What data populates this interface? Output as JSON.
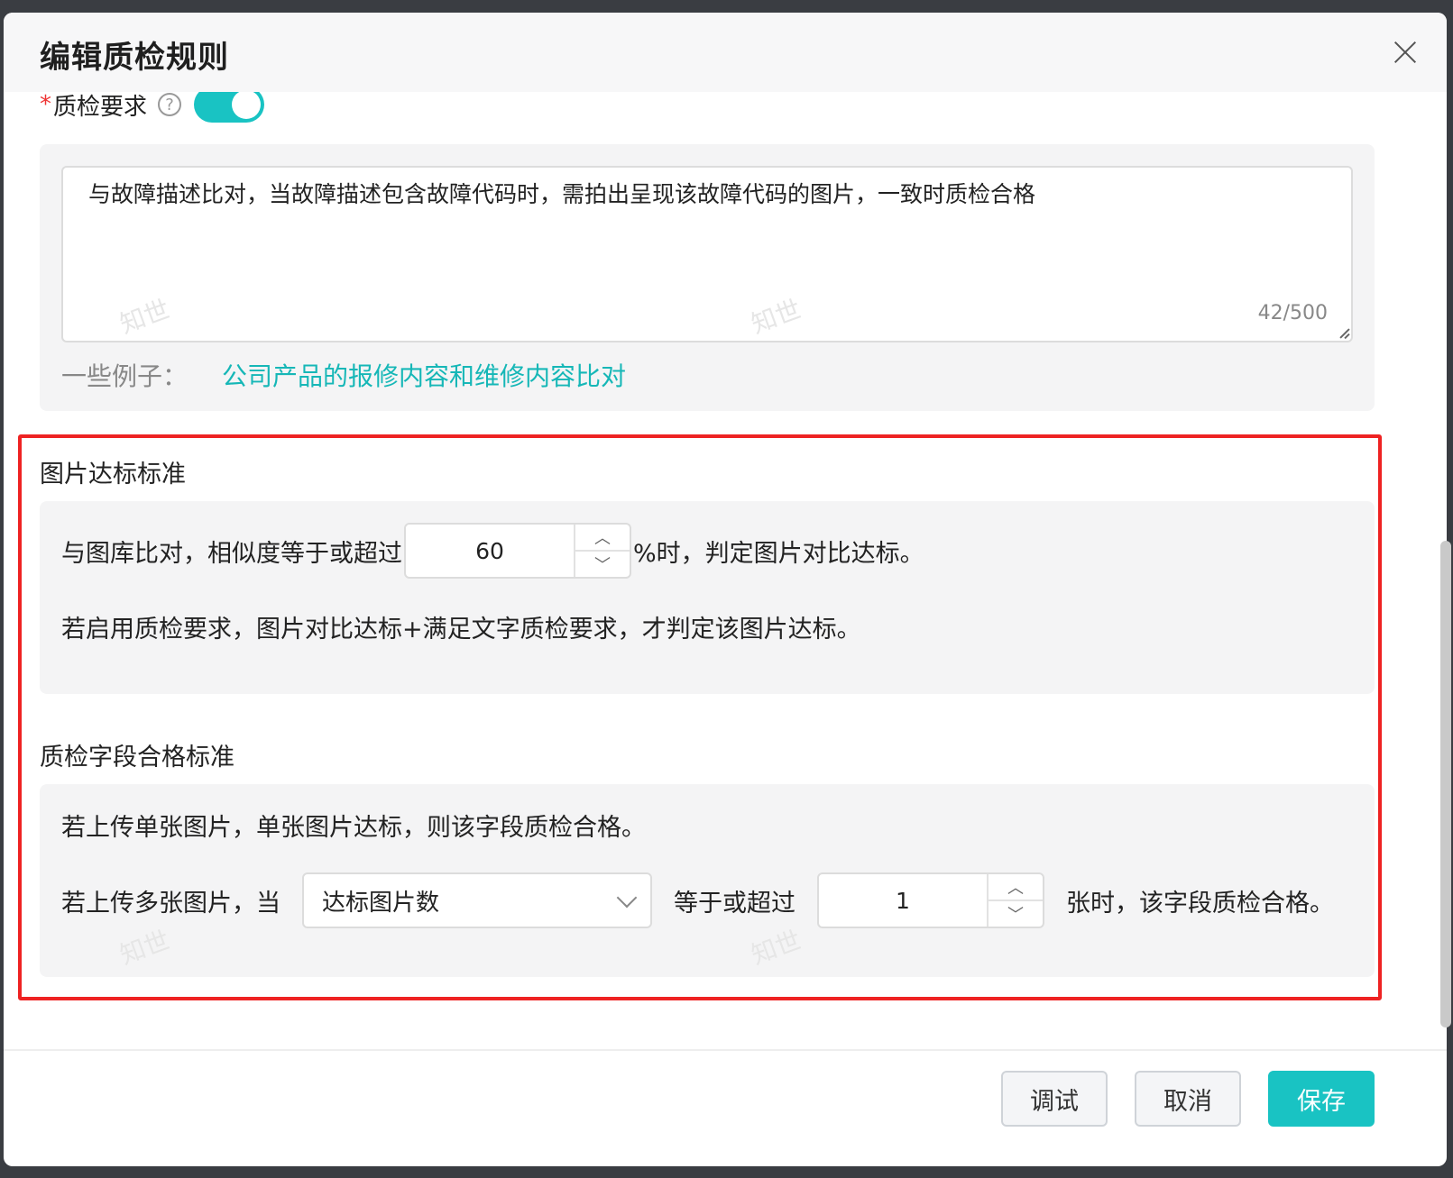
{
  "dialog": {
    "title": "编辑质检规则"
  },
  "requirement": {
    "label": "质检要求",
    "required_mark": "*",
    "help_glyph": "?",
    "toggle_on": true,
    "text": "与故障描述比对，当故障描述包含故障代码时，需拍出呈现该故障代码的图片，一致时质检合格",
    "counter": "42/500",
    "examples_label": "一些例子：",
    "example_link": "公司产品的报修内容和维修内容比对"
  },
  "image_standard": {
    "title": "图片达标标准",
    "line1_prefix": "与图库比对，相似度等于或超过",
    "similarity_value": "60",
    "line1_suffix": "%时，判定图片对比达标。",
    "line2": "若启用质检要求，图片对比达标+满足文字质检要求，才判定该图片达标。"
  },
  "field_standard": {
    "title": "质检字段合格标准",
    "line1": "若上传单张图片，单张图片达标，则该字段质检合格。",
    "line2_prefix": "若上传多张图片，当",
    "select_value": "达标图片数",
    "line2_mid": "等于或超过",
    "count_value": "1",
    "line2_suffix": "张时，该字段质检合格。"
  },
  "footer": {
    "debug_label": "调试",
    "cancel_label": "取消",
    "save_label": "保存"
  },
  "watermark_text": "知世",
  "colors": {
    "accent": "#19c3c3",
    "highlight_frame": "#ee2222",
    "panel_bg": "#f4f4f5"
  }
}
